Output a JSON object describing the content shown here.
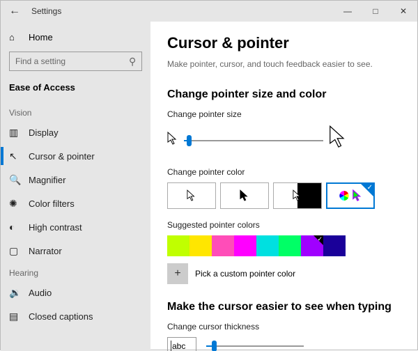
{
  "window": {
    "title": "Settings"
  },
  "home": {
    "label": "Home"
  },
  "search": {
    "placeholder": "Find a setting"
  },
  "category": "Ease of Access",
  "groups": {
    "vision": "Vision",
    "hearing": "Hearing"
  },
  "nav": {
    "display": "Display",
    "cursor": "Cursor & pointer",
    "magnifier": "Magnifier",
    "colorfilters": "Color filters",
    "highcontrast": "High contrast",
    "narrator": "Narrator",
    "audio": "Audio",
    "cc": "Closed captions"
  },
  "page": {
    "title": "Cursor & pointer",
    "subtitle": "Make pointer, cursor, and touch feedback easier to see.",
    "section1": "Change pointer size and color",
    "sizeLabel": "Change pointer size",
    "colorLabel": "Change pointer color",
    "suggestedLabel": "Suggested pointer colors",
    "pickLabel": "Pick a custom pointer color",
    "section2": "Make the cursor easier to see when typing",
    "thickLabel": "Change cursor thickness",
    "sample": "abc"
  },
  "suggested_colors": [
    "#c0ff00",
    "#ffe600",
    "#ff4db8",
    "#ff00ff",
    "#00e0e0",
    "#00ff66",
    "#a000ff",
    "#1a0099"
  ],
  "selected_suggested": 6,
  "selected_color_mode": 3,
  "pointer_size_pct": 2,
  "cursor_thickness_pct": 6
}
